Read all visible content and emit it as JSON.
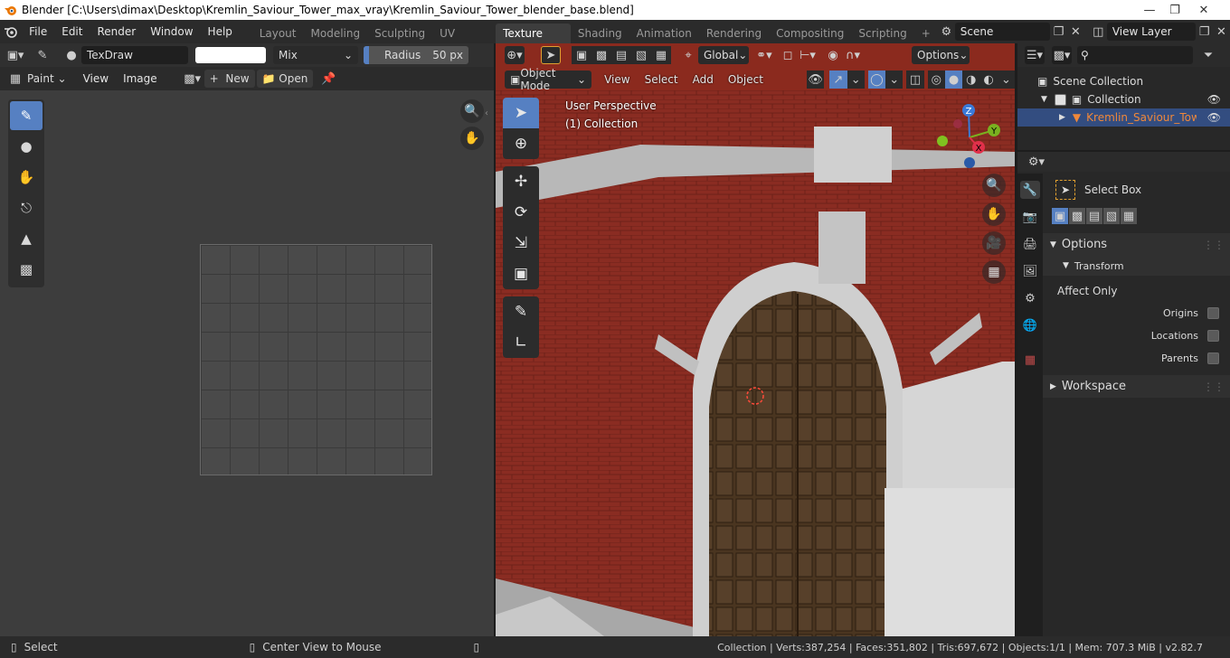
{
  "window": {
    "title": "Blender [C:\\Users\\dimax\\Desktop\\Kremlin_Saviour_Tower_max_vray\\Kremlin_Saviour_Tower_blender_base.blend]",
    "controls": [
      "minimize-icon",
      "restore-icon",
      "close-icon"
    ]
  },
  "menubar": {
    "items": [
      "File",
      "Edit",
      "Render",
      "Window",
      "Help"
    ]
  },
  "workspaces": {
    "tabs": [
      "Layout",
      "Modeling",
      "Sculpting",
      "UV Editing",
      "Texture Paint",
      "Shading",
      "Animation",
      "Rendering",
      "Compositing",
      "Scripting"
    ],
    "active": "Texture Paint",
    "add": "+"
  },
  "scene": {
    "name": "Scene"
  },
  "view_layer": {
    "name": "View Layer"
  },
  "image_editor": {
    "brush_name": "TexDraw",
    "blend_mode": "Mix",
    "radius_label": "Radius",
    "radius_value": "50 px",
    "mode": "Paint",
    "menus": [
      "View",
      "Image"
    ],
    "new_label": "New",
    "open_label": "Open",
    "tools": [
      "draw-brush-icon",
      "soften-icon",
      "smear-icon",
      "clone-icon",
      "fill-icon",
      "mask-icon"
    ]
  },
  "viewport": {
    "options_label": "Options",
    "transform_orientation": "Global",
    "mode": "Object Mode",
    "menus": [
      "View",
      "Select",
      "Add",
      "Object"
    ],
    "perspective_label": "User Perspective",
    "collection_label": "(1) Collection",
    "gizmo": {
      "x": "X",
      "y": "Y",
      "z": "Z"
    },
    "tools": [
      "select-box-icon",
      "cursor-icon",
      "move-icon",
      "rotate-icon",
      "scale-icon",
      "transform-icon",
      "annotate-icon",
      "measure-icon"
    ]
  },
  "outliner": {
    "search_placeholder": "",
    "root": "Scene Collection",
    "collection": "Collection",
    "object": "Kremlin_Saviour_Tower_"
  },
  "properties": {
    "tool_name": "Select Box",
    "options_label": "Options",
    "transform_label": "Transform",
    "affect_only_label": "Affect Only",
    "origins_label": "Origins",
    "locations_label": "Locations",
    "parents_label": "Parents",
    "workspace_label": "Workspace"
  },
  "statusbar": {
    "select": "Select",
    "center_view": "Center View to Mouse",
    "stats": "Collection | Verts:387,254 | Faces:351,802 | Tris:697,672 | Objects:1/1 | Mem: 707.3 MiB | v2.82.7"
  },
  "colors": {
    "accent": "#5680c2",
    "selected_object": "#f0883a",
    "brick": "#8b2a1e"
  }
}
